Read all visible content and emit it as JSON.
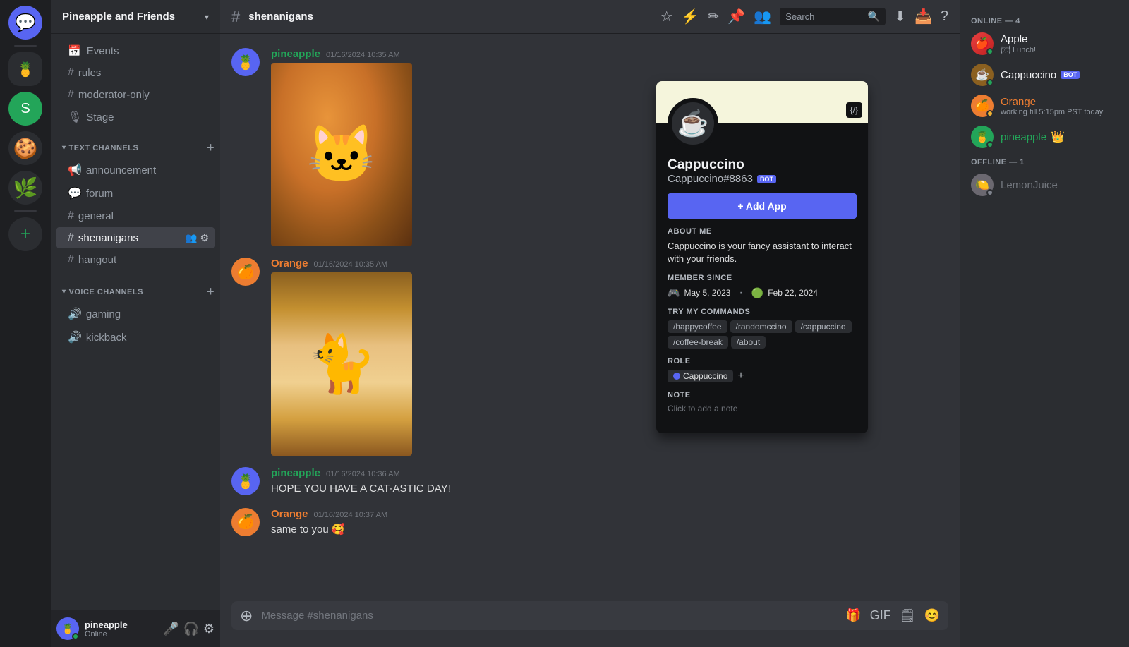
{
  "server": {
    "name": "Pineapple and Friends",
    "chevron": "▾"
  },
  "servers": [
    {
      "id": "discord",
      "icon": "💬",
      "label": "Discord Home"
    },
    {
      "id": "pineapple",
      "icon": "🍍",
      "label": "Pineapple and Friends"
    },
    {
      "id": "green",
      "icon": "S",
      "label": "Server S"
    },
    {
      "id": "cookie",
      "icon": "🍪",
      "label": "Cookie Server"
    },
    {
      "id": "lime",
      "icon": "🌿",
      "label": "Lime Server"
    },
    {
      "id": "add",
      "icon": "+",
      "label": "Add Server"
    }
  ],
  "sidebar": {
    "misc": [
      {
        "icon": "📅",
        "name": "Events",
        "label": "Events"
      }
    ],
    "channels_before_text": [
      {
        "icon": "#",
        "name": "rules",
        "label": "rules"
      },
      {
        "icon": "#",
        "name": "moderator-only",
        "label": "moderator-only"
      },
      {
        "icon": "🎙",
        "name": "Stage",
        "label": "Stage"
      }
    ],
    "text_channels_header": "TEXT CHANNELS",
    "text_channels": [
      {
        "icon": "📢",
        "name": "announcement",
        "label": "announcement"
      },
      {
        "icon": "💬",
        "name": "forum",
        "label": "forum"
      },
      {
        "icon": "#",
        "name": "general",
        "label": "general"
      },
      {
        "icon": "#",
        "name": "shenanigans",
        "label": "shenanigans",
        "active": true
      },
      {
        "icon": "#",
        "name": "hangout",
        "label": "hangout"
      }
    ],
    "voice_channels_header": "VOICE CHANNELS",
    "voice_channels": [
      {
        "icon": "🔊",
        "name": "gaming",
        "label": "gaming"
      },
      {
        "icon": "🔊",
        "name": "kickback",
        "label": "kickback"
      }
    ],
    "footer": {
      "username": "pineapple",
      "status": "Online",
      "avatar_emoji": "🍍"
    }
  },
  "channel": {
    "name": "shenanigans",
    "hash": "#"
  },
  "header_icons": {
    "star": "☆",
    "hammer": "🔨",
    "edit": "✏",
    "pin": "📌",
    "friends": "👥",
    "search_placeholder": "Search",
    "download": "⬇",
    "inbox": "📥",
    "help": "?"
  },
  "messages": [
    {
      "id": 1,
      "author": "pineapple",
      "author_color": "pineapple",
      "timestamp": "01/16/2024 10:35 AM",
      "has_image": true,
      "image_type": "cat1",
      "text": ""
    },
    {
      "id": 2,
      "author": "Orange",
      "author_color": "orange",
      "timestamp": "01/16/2024 10:35 AM",
      "has_image": true,
      "image_type": "cat2",
      "text": ""
    },
    {
      "id": 3,
      "author": "pineapple",
      "author_color": "pineapple",
      "timestamp": "01/16/2024 10:36 AM",
      "has_image": false,
      "text": "HOPE YOU HAVE A CAT-ASTIC DAY!"
    },
    {
      "id": 4,
      "author": "Orange",
      "author_color": "orange",
      "timestamp": "01/16/2024 10:37 AM",
      "has_image": false,
      "text": "same to you 🥰"
    }
  ],
  "message_input_placeholder": "Message #shenanigans",
  "members": {
    "online_header": "ONLINE — 4",
    "online": [
      {
        "name": "Apple",
        "sub": "🍽 Lunch!",
        "avatar": "🍎",
        "status": "online",
        "av_class": "apple-av"
      },
      {
        "name": "Cappuccino",
        "sub": "",
        "avatar": "☕",
        "status": "online",
        "av_class": "cappuccino-av",
        "is_bot": true,
        "badge": "BOT"
      },
      {
        "name": "Orange",
        "sub": "working till 5:15pm PST today",
        "avatar": "🍊",
        "status": "idle",
        "av_class": "orange-av-sm"
      },
      {
        "name": "pineapple",
        "sub": "",
        "avatar": "🍍",
        "status": "online",
        "av_class": "pineapple-av-sm",
        "emoji": "👑"
      }
    ],
    "offline_header": "OFFLINE — 1",
    "offline": [
      {
        "name": "LemonJuice",
        "sub": "",
        "avatar": "🍋",
        "status": "offline",
        "av_class": "lemon-av"
      }
    ]
  },
  "profile": {
    "name": "Cappuccino",
    "tag": "Cappuccino#8863",
    "is_bot": true,
    "bot_badge": "BOT",
    "add_app_label": "+ Add App",
    "about_title": "ABOUT ME",
    "about_text": "Cappuccino is your fancy assistant to interact with your friends.",
    "member_since_title": "MEMBER SINCE",
    "joined_discord": "May 5, 2023",
    "joined_server": "Feb 22, 2024",
    "commands_title": "TRY MY COMMANDS",
    "commands": [
      "/happycoffee",
      "/randomccino",
      "/cappuccino",
      "/coffee-break",
      "/about"
    ],
    "role_title": "ROLE",
    "role_name": "Cappuccino",
    "note_title": "NOTE",
    "note_placeholder": "Click to add a note",
    "code_icon": "{/}"
  }
}
